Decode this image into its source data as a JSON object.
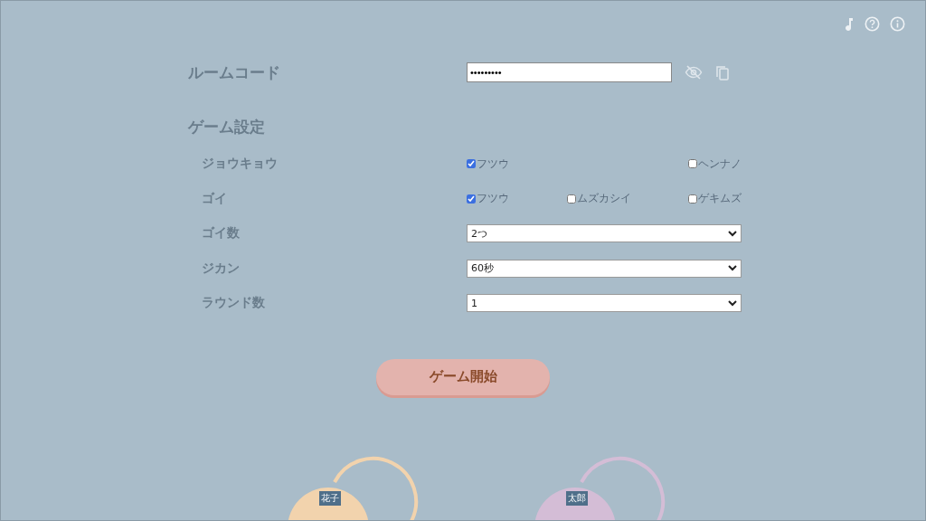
{
  "room_code": {
    "label": "ルームコード",
    "value": "•••••••••"
  },
  "settings": {
    "title": "ゲーム設定",
    "rows": [
      {
        "kind": "checkboxes",
        "label": "ジョウキョウ",
        "options": [
          {
            "label": "フツウ",
            "checked": true
          },
          {
            "label": "ヘンナノ",
            "checked": false
          }
        ]
      },
      {
        "kind": "checkboxes",
        "label": "ゴイ",
        "options": [
          {
            "label": "フツウ",
            "checked": true
          },
          {
            "label": "ムズカシイ",
            "checked": false
          },
          {
            "label": "ゲキムズ",
            "checked": false
          }
        ]
      },
      {
        "kind": "select",
        "label": "ゴイ数",
        "value": "2つ"
      },
      {
        "kind": "select",
        "label": "ジカン",
        "value": "60秒"
      },
      {
        "kind": "select",
        "label": "ラウンド数",
        "value": "1"
      }
    ]
  },
  "start_button": {
    "label": "ゲーム開始"
  },
  "players": [
    {
      "name": "花子",
      "color": "#f2d3ad"
    },
    {
      "name": "太郎",
      "color": "#d4bdd6"
    }
  ]
}
